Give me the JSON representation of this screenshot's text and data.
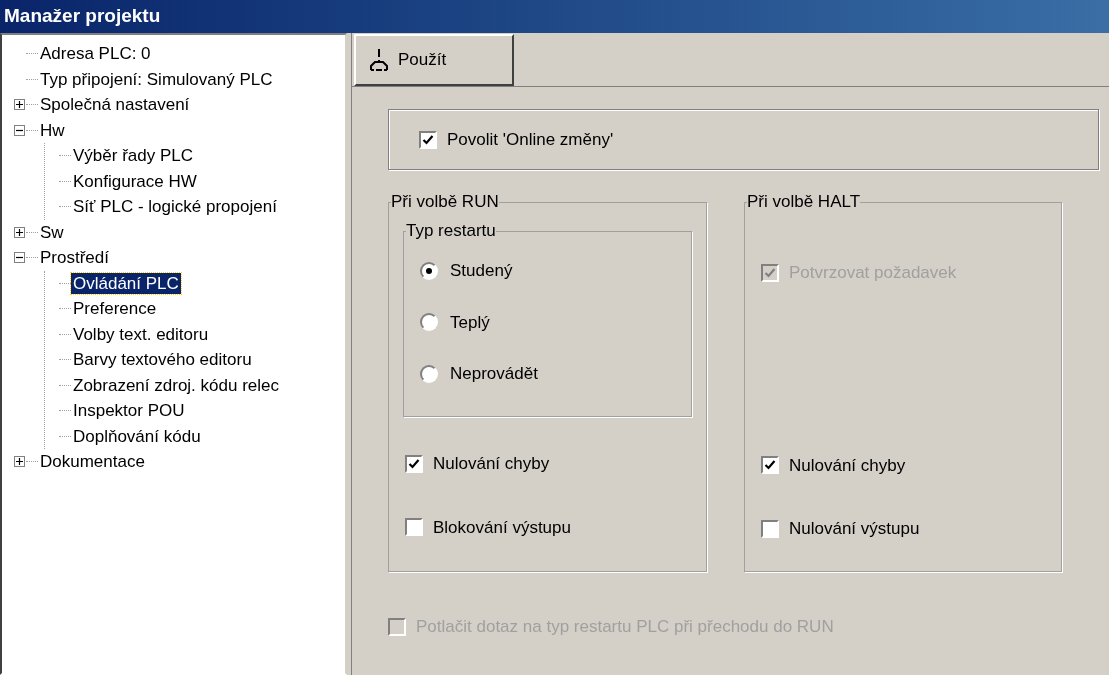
{
  "window": {
    "title": "Manažer projektu"
  },
  "tree": [
    {
      "label": "Adresa PLC: 0",
      "selected": false
    },
    {
      "label": "Typ připojení: Simulovaný PLC",
      "selected": false
    },
    {
      "label": "Společná nastavení",
      "selected": false,
      "expanded": false
    },
    {
      "label": "Hw",
      "selected": false,
      "expanded": true,
      "children": [
        {
          "label": "Výběr řady PLC",
          "selected": false
        },
        {
          "label": "Konfigurace HW",
          "selected": false
        },
        {
          "label": "Síť PLC - logické propojení",
          "selected": false
        }
      ]
    },
    {
      "label": "Sw",
      "selected": false,
      "expanded": false
    },
    {
      "label": "Prostředí",
      "selected": false,
      "expanded": true,
      "children": [
        {
          "label": "Ovládání PLC",
          "selected": true
        },
        {
          "label": "Preference",
          "selected": false
        },
        {
          "label": "Volby text. editoru",
          "selected": false
        },
        {
          "label": "Barvy textového editoru",
          "selected": false
        },
        {
          "label": "Zobrazení zdroj. kódu relec",
          "selected": false
        },
        {
          "label": "Inspektor POU",
          "selected": false
        },
        {
          "label": "Doplňování kódu",
          "selected": false
        }
      ]
    },
    {
      "label": "Dokumentace",
      "selected": false,
      "expanded": false
    }
  ],
  "toolbar": {
    "apply_button": "Použít"
  },
  "online_changes": {
    "label": "Povolit 'Online změny'",
    "checked": true,
    "disabled": false
  },
  "run_group": {
    "title": "Při volbě RUN",
    "restart_group": {
      "title": "Typ restartu",
      "options": [
        {
          "label": "Studený",
          "selected": true
        },
        {
          "label": "Teplý",
          "selected": false
        },
        {
          "label": "Neprovádět",
          "selected": false
        }
      ]
    },
    "checkboxes": [
      {
        "label": "Nulování chyby",
        "checked": true,
        "disabled": false
      },
      {
        "label": "Blokování výstupu",
        "checked": false,
        "disabled": false
      }
    ]
  },
  "halt_group": {
    "title": "Při volbě HALT",
    "confirm": {
      "label": "Potvrzovat požadavek",
      "checked": true,
      "disabled": true
    },
    "checkboxes": [
      {
        "label": "Nulování chyby",
        "checked": true,
        "disabled": false
      },
      {
        "label": "Nulování výstupu",
        "checked": false,
        "disabled": false
      }
    ]
  },
  "suppress_query": {
    "label": "Potlačit dotaz na typ restartu PLC při přechodu do RUN",
    "checked": false,
    "disabled": true
  }
}
